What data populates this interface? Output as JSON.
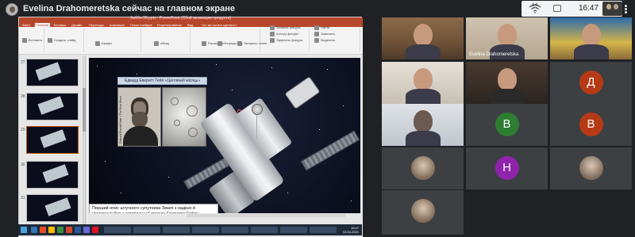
{
  "top_bar": {
    "presenter_icon": "presenter-avatar-icon",
    "title": "Evelina Drahomeretska сейчас на главном экране",
    "battery_label": "14",
    "time": "16:47"
  },
  "presentation": {
    "app": "PowerPoint",
    "doc_title": "Хаббл-30.pptx - PowerPoint (Сбой активации продукта)",
    "tabs": [
      "Файл",
      "Главная",
      "Вставка",
      "Дизайн",
      "Переходы",
      "Анимация",
      "Показ слайдов",
      "Рецензирование",
      "Вид",
      "Что вы хотите сделать?"
    ],
    "ribbon_labels": [
      "Вставить",
      "Создать слайд",
      "Шрифт",
      "Абзац",
      "Рисование",
      "Упорядочить",
      "Экспресс-стили",
      "Заливка фигуры",
      "Контур фигуры",
      "Эффекты фигуры",
      "Найти",
      "Заменить",
      "Выделить"
    ],
    "slide": {
      "caption": "Едвард Еверетт Гейл «Цегляний місяць»",
      "portrait_side_text": "Edward Everett Hale • The Brick Moon",
      "body_text": "Перший опис штучного супутника Землі з надією й ілюстрації був у оповіданні Едварда Еверетта Гейла «Цегляний місяць»"
    },
    "notes_hint": "Если вы хотите продолжить представление докладчика, нажмите здесь",
    "share_button": "Прекратить показ",
    "taskbar_clock": "16:47\n03.04.2021"
  },
  "participants": [
    {
      "name": "",
      "type": "video",
      "style": "cam1"
    },
    {
      "name": "Evelina Drahomeretska",
      "type": "video",
      "style": "cam2"
    },
    {
      "name": "",
      "type": "video",
      "style": "cam3"
    },
    {
      "name": "",
      "type": "video",
      "style": "cam4"
    },
    {
      "name": "",
      "type": "video",
      "style": "cam5"
    },
    {
      "name": "",
      "type": "avatar",
      "letter": "Д",
      "color": "#b53a15"
    },
    {
      "name": "",
      "type": "video",
      "style": "cam6"
    },
    {
      "name": "",
      "type": "avatar",
      "letter": "В",
      "color": "#2e7d32"
    },
    {
      "name": "",
      "type": "avatar",
      "letter": "В",
      "color": "#b53a15"
    },
    {
      "name": "",
      "type": "photo"
    },
    {
      "name": "",
      "type": "avatar",
      "letter": "Н",
      "color": "#8e24aa"
    },
    {
      "name": "",
      "type": "photo"
    },
    {
      "name": "",
      "type": "photo"
    }
  ],
  "colors": {
    "background": "#202124",
    "tile": "#3c4043",
    "ppt_accent": "#b7472a",
    "active_speaker": "#1a73e8"
  }
}
